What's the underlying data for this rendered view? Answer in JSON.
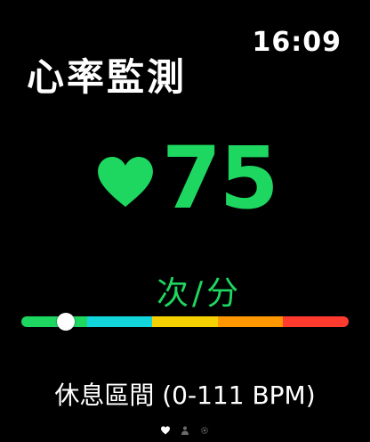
{
  "status_bar": {
    "time": "16:09"
  },
  "screen": {
    "title": "心率監測"
  },
  "heart_rate": {
    "value": "75",
    "unit": "次/分",
    "icon": "heart-icon"
  },
  "zone_bar": {
    "position": 0.135,
    "segments": [
      {
        "color": "#1ed760"
      },
      {
        "color": "#12d6dc"
      },
      {
        "color": "#f5d000"
      },
      {
        "color": "#ff9800"
      },
      {
        "color": "#ff3b30"
      }
    ]
  },
  "zone": {
    "label": "休息區間 (0-111 BPM)"
  },
  "page_indicator": {
    "icons": [
      "heart-icon",
      "person-icon",
      "gear-icon"
    ],
    "active_index": 0
  },
  "colors": {
    "accent": "#1ed760",
    "background": "#000000",
    "text": "#ffffff",
    "indicator_inactive": "#6b6b6b"
  }
}
